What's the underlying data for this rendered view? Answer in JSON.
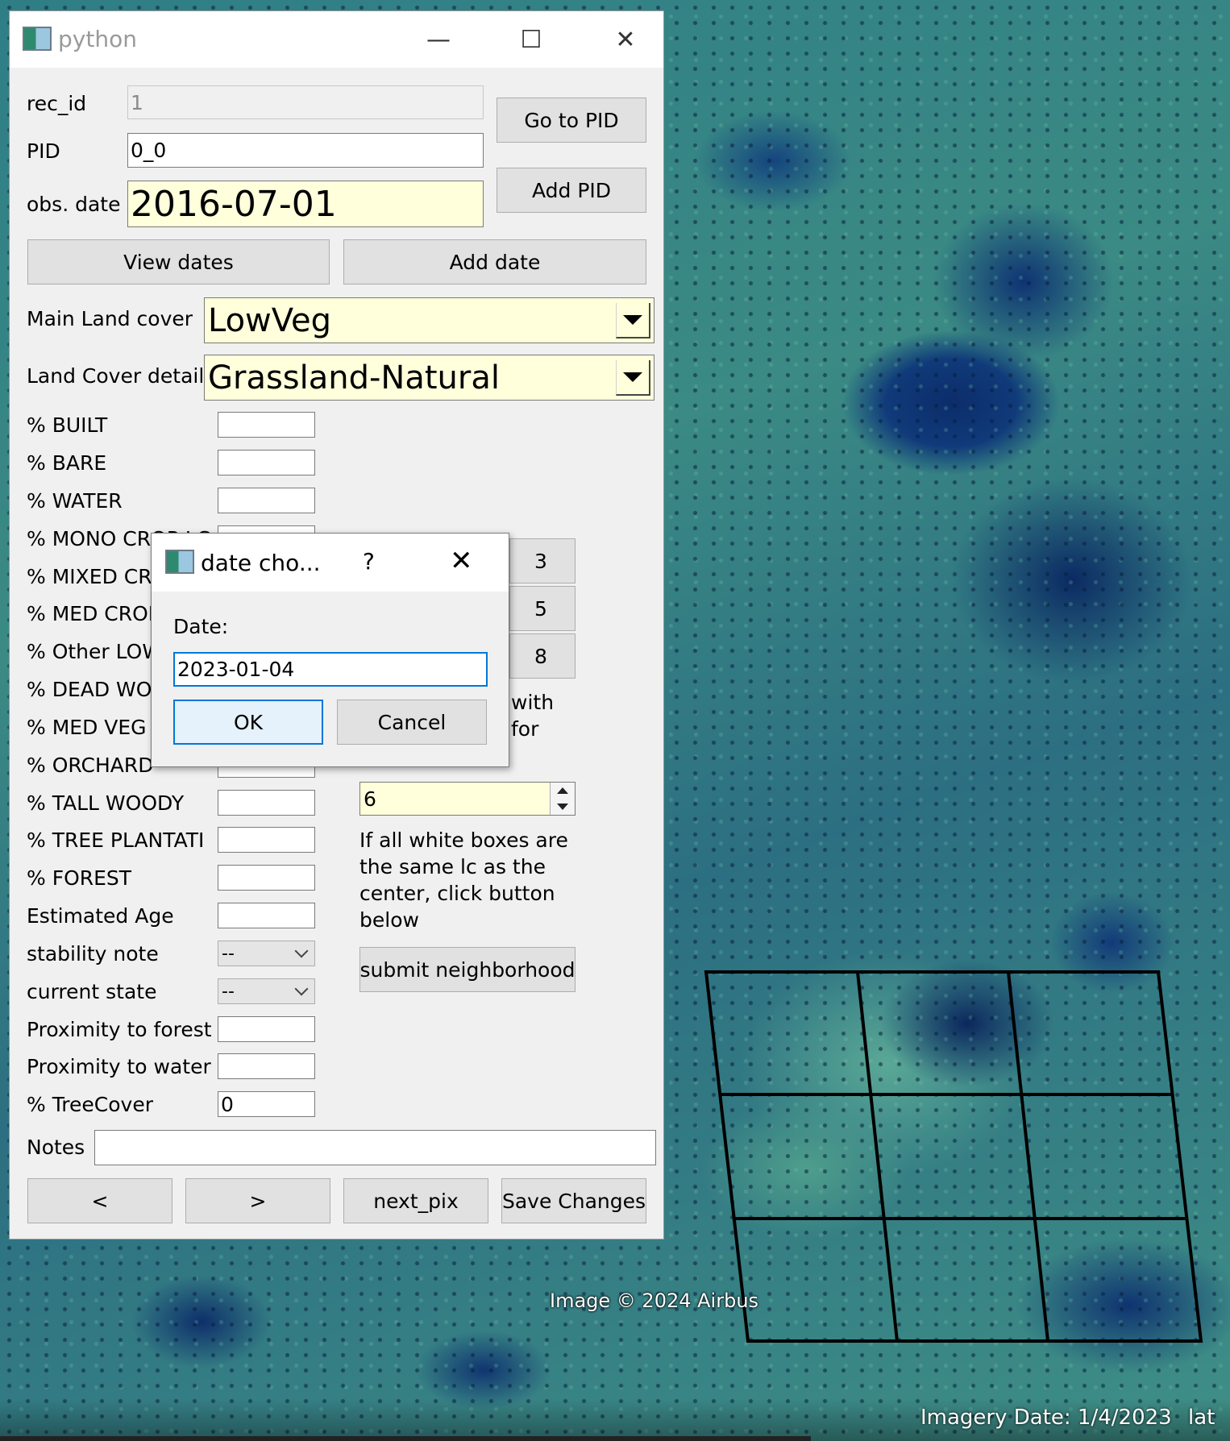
{
  "window": {
    "title": "python",
    "minimize_glyph": "—",
    "maximize_glyph": "☐",
    "close_glyph": "✕"
  },
  "record": {
    "rec_id_label": "rec_id",
    "rec_id_value": "1",
    "pid_label": "PID",
    "pid_value": "0_0",
    "obs_date_label": "obs. date",
    "obs_date_value": "2016-07-01",
    "go_to_pid": "Go to PID",
    "add_pid": "Add PID",
    "view_dates": "View dates",
    "add_date": "Add date"
  },
  "landcover": {
    "main_label": "Main Land cover",
    "main_value": "LowVeg",
    "detail_label": "Land Cover detail",
    "detail_value": "Grassland-Natural"
  },
  "percent_fields": [
    {
      "label": "% BUILT",
      "value": ""
    },
    {
      "label": "% BARE",
      "value": ""
    },
    {
      "label": "% WATER",
      "value": ""
    },
    {
      "label": "% MONO CROP LC",
      "value": ""
    },
    {
      "label": "% MIXED CR",
      "value": ""
    },
    {
      "label": "% MED CROP",
      "value": ""
    },
    {
      "label": "% Other LOW",
      "value": ""
    },
    {
      "label": "% DEAD WOO",
      "value": ""
    },
    {
      "label": "% MED VEG",
      "value": ""
    },
    {
      "label": "% ORCHARD",
      "value": ""
    },
    {
      "label": "% TALL WOODY",
      "value": ""
    },
    {
      "label": "% TREE PLANTATI",
      "value": ""
    },
    {
      "label": "% FOREST",
      "value": ""
    },
    {
      "label": "Estimated Age",
      "value": ""
    }
  ],
  "stability_note": {
    "label": "stability note",
    "value": "--"
  },
  "current_state": {
    "label": "current state",
    "value": "--"
  },
  "proximity_forest": {
    "label": "Proximity to forest",
    "value": ""
  },
  "proximity_water": {
    "label": "Proximity to water",
    "value": ""
  },
  "tree_cover": {
    "label": "% TreeCover",
    "value": "0"
  },
  "notes": {
    "label": "Notes",
    "value": ""
  },
  "neighborhood": {
    "side_buttons": [
      "3",
      "5",
      "8"
    ],
    "partial_text_1": "with",
    "partial_text_2": "for",
    "spin_value": "6",
    "instructions": [
      "If all white boxes are",
      "the same lc as the",
      "center, click button",
      "below"
    ],
    "submit_label": "submit neighborhood"
  },
  "nav": {
    "prev": "<",
    "next": ">",
    "next_pix": "next_pix",
    "save": "Save Changes"
  },
  "dialog": {
    "title": "date cho...",
    "help": "?",
    "close": "✕",
    "date_label": "Date:",
    "date_value": "2023-01-04",
    "ok": "OK",
    "cancel": "Cancel"
  },
  "map": {
    "attribution": "Image © 2024 Airbus",
    "imagery_date": "Imagery Date: 1/4/2023",
    "lat_label": "lat"
  },
  "colors": {
    "field_highlight": "#ffffdc",
    "ok_button_highlight": "#e5f1fb",
    "focus_border": "#0078d7"
  }
}
